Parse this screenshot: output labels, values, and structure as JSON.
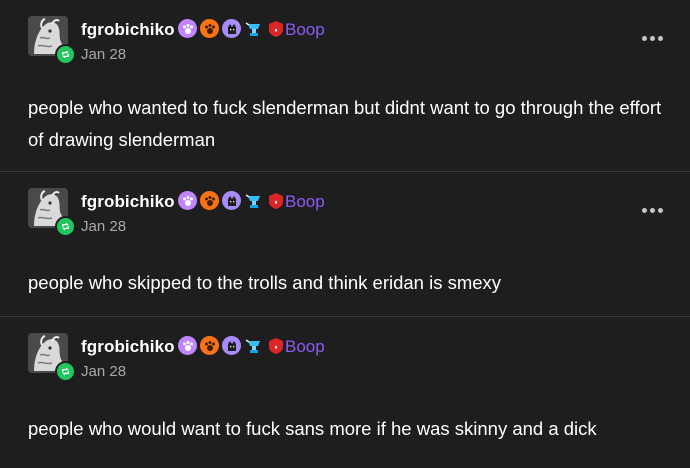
{
  "colors": {
    "background": "#1f1e1f",
    "divider": "#3b3a3b",
    "boop": "#8b5cf6",
    "date": "#a8a8a8",
    "reblog_badge": "#22c55e"
  },
  "posts": [
    {
      "username": "fgrobichiko",
      "badges": [
        "purple-paw-badge",
        "orange-paw-badge",
        "purple-cat-badge",
        "blue-trophy-badge",
        "red-shield-badge"
      ],
      "boop_label": "Boop",
      "date": "Jan 28",
      "text": "people who wanted to fuck slenderman but didnt want to go through the effort of drawing slenderman"
    },
    {
      "username": "fgrobichiko",
      "badges": [
        "purple-paw-badge",
        "orange-paw-badge",
        "purple-cat-badge",
        "blue-trophy-badge",
        "red-shield-badge"
      ],
      "boop_label": "Boop",
      "date": "Jan 28",
      "text": "people who skipped to the trolls and think eridan is smexy"
    },
    {
      "username": "fgrobichiko",
      "badges": [
        "purple-paw-badge",
        "orange-paw-badge",
        "purple-cat-badge",
        "blue-trophy-badge",
        "red-shield-badge"
      ],
      "boop_label": "Boop",
      "date": "Jan 28",
      "text": "people who would want to fuck sans more if he was skinny and a dick"
    }
  ]
}
